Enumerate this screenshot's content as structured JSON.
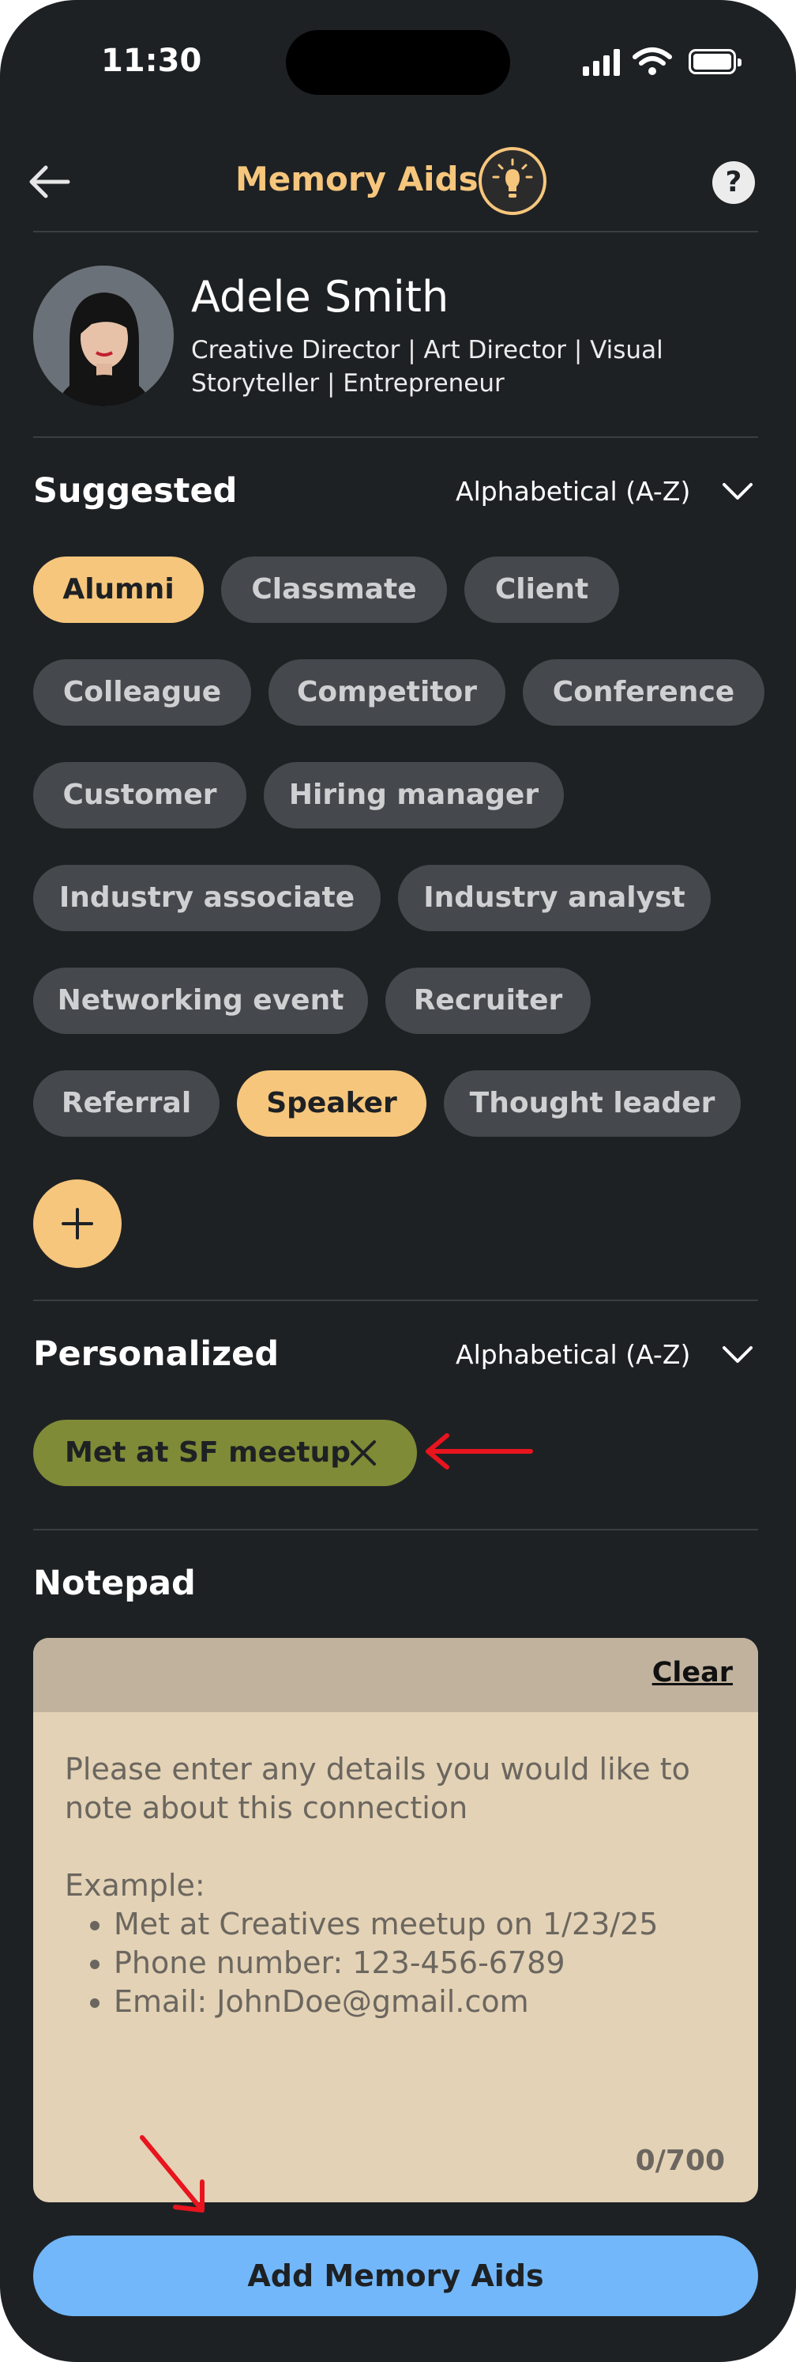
{
  "status_bar": {
    "time": "11:30"
  },
  "header": {
    "title": "Memory Aids",
    "help_label": "?"
  },
  "profile": {
    "name": "Adele Smith",
    "headline": "Creative Director | Art Director | Visual Storyteller | Entrepreneur"
  },
  "suggested": {
    "title": "Suggested",
    "sort_label": "Alphabetical (A-Z)",
    "chips": [
      {
        "label": "Alumni",
        "selected": true
      },
      {
        "label": "Classmate",
        "selected": false
      },
      {
        "label": "Client",
        "selected": false
      },
      {
        "label": "Colleague",
        "selected": false
      },
      {
        "label": "Competitor",
        "selected": false
      },
      {
        "label": "Conference",
        "selected": false
      },
      {
        "label": "Customer",
        "selected": false
      },
      {
        "label": "Hiring manager",
        "selected": false
      },
      {
        "label": "Industry associate",
        "selected": false
      },
      {
        "label": "Industry analyst",
        "selected": false
      },
      {
        "label": "Networking event",
        "selected": false
      },
      {
        "label": "Recruiter",
        "selected": false
      },
      {
        "label": "Referral",
        "selected": false
      },
      {
        "label": "Speaker",
        "selected": true
      },
      {
        "label": "Thought leader",
        "selected": false
      }
    ]
  },
  "personalized": {
    "title": "Personalized",
    "sort_label": "Alphabetical (A-Z)",
    "chips": [
      {
        "label": "Met at SF meetup"
      }
    ]
  },
  "notepad": {
    "title": "Notepad",
    "clear_label": "Clear",
    "placeholder_intro": "Please enter any details you would like to note about this connection",
    "example_label": "Example:",
    "example_items": [
      "Met at Creatives meetup on 1/23/25",
      "Phone number: 123-456-6789",
      "Email: JohnDoe@gmail.com"
    ],
    "counter": "0/700"
  },
  "add_button": {
    "label": "Add Memory Aids"
  },
  "colors": {
    "background": "#1e2124",
    "accent": "#f6c67c",
    "chip": "#45484c",
    "personal_chip": "#7f8b36",
    "notepad": "#e3d2b5",
    "primary_button": "#72b7f9",
    "annotation_arrow": "#e8141e"
  }
}
